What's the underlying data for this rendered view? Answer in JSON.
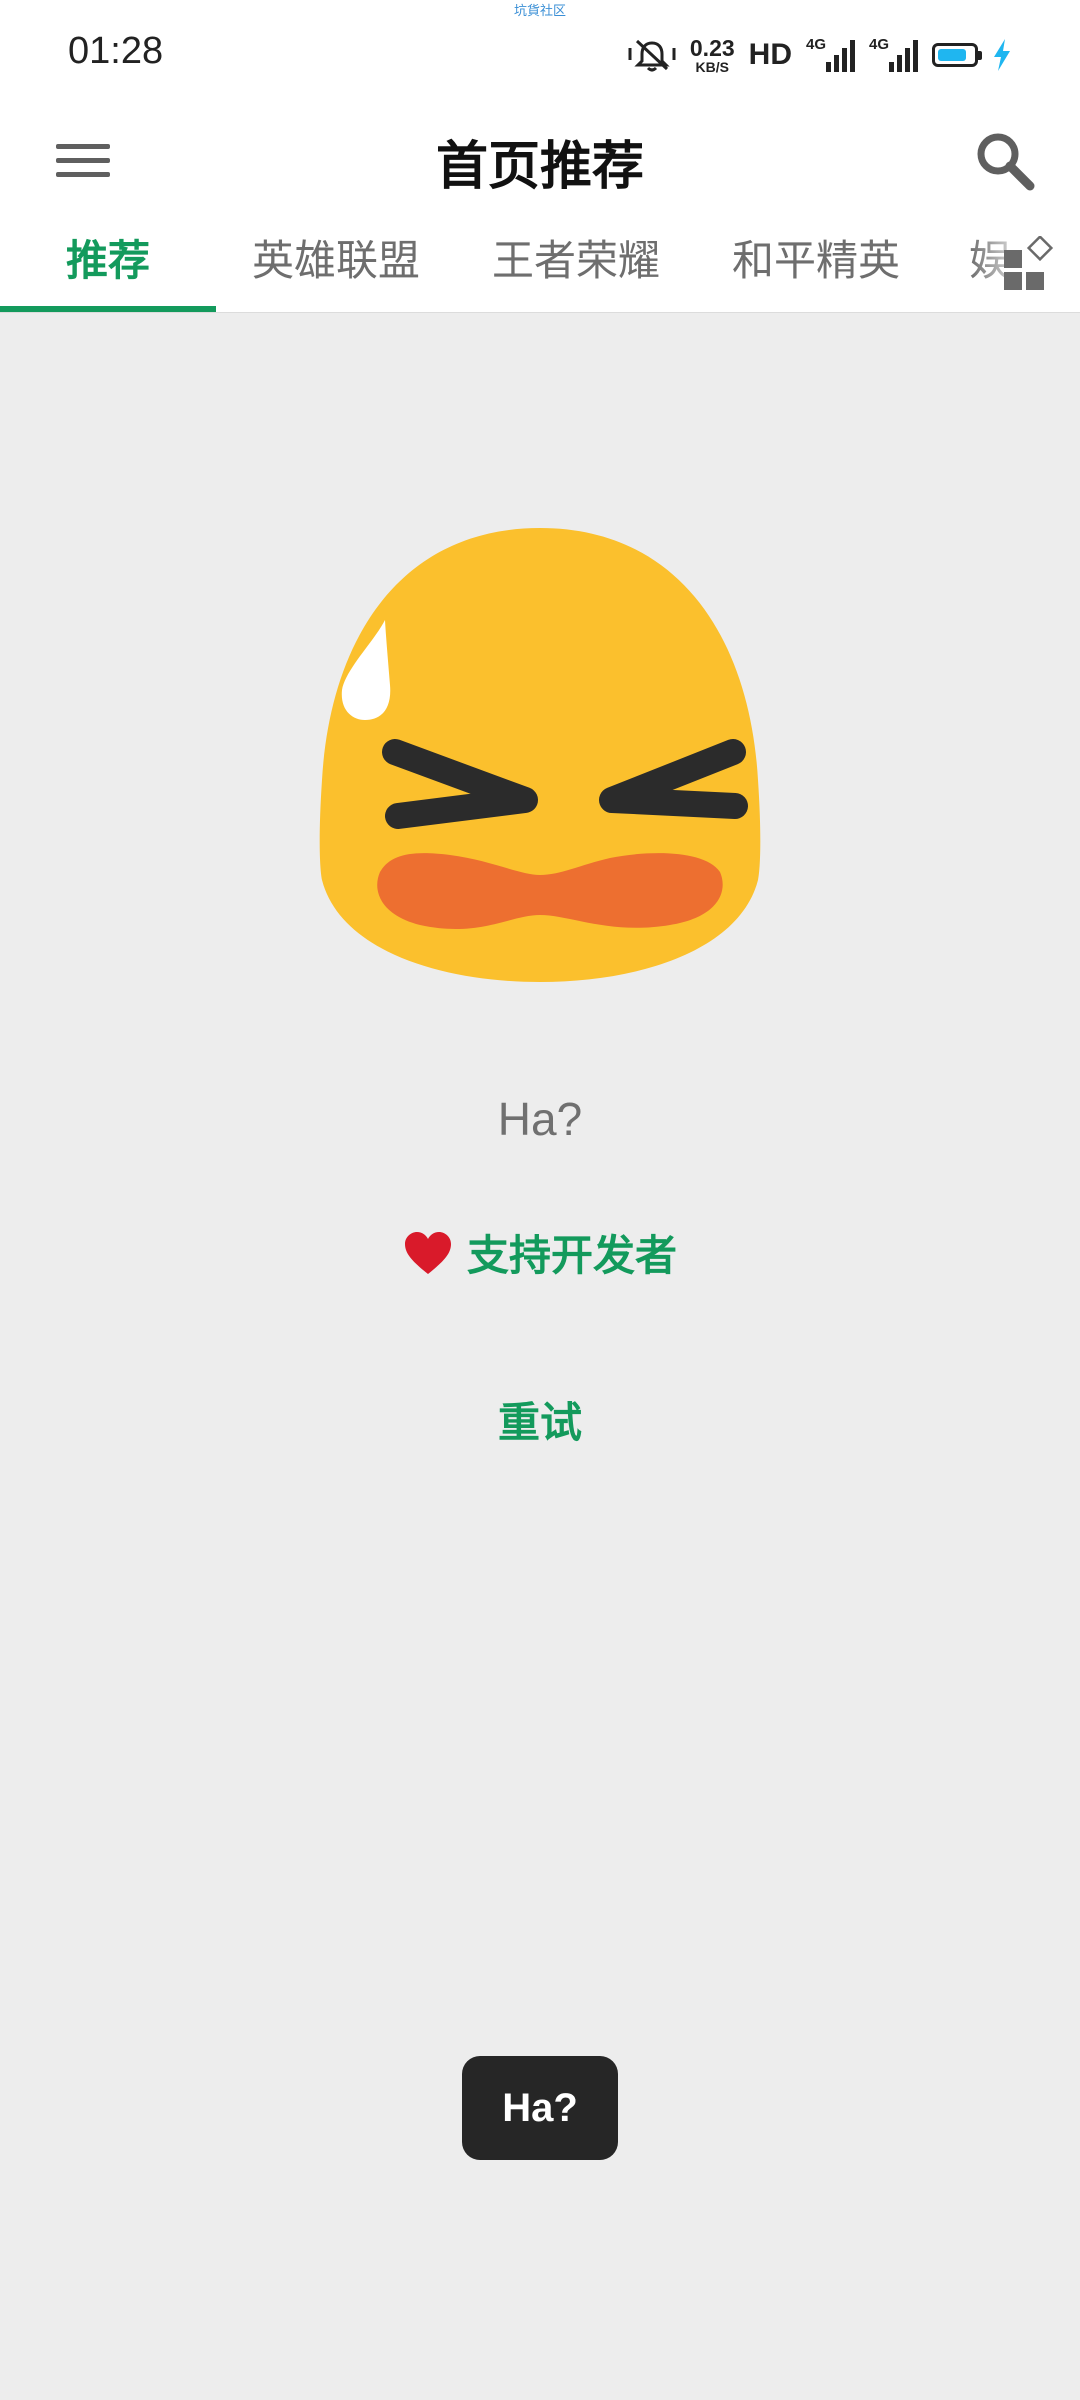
{
  "status_bar": {
    "top_label": "坑貨社区",
    "time": "01:28",
    "speed_value": "0.23",
    "speed_unit": "KB/S",
    "hd_label": "HD",
    "network_1": "4G",
    "network_2": "4G",
    "battery_color": "#1fb6f0",
    "icons": [
      "mute-vibrate-icon",
      "signal-icon",
      "battery-icon",
      "charging-icon"
    ]
  },
  "app_bar": {
    "title": "首页推荐",
    "menu_icon": "hamburger-menu-icon",
    "search_icon": "search-icon"
  },
  "tabs": [
    {
      "label": "推荐",
      "active": true
    },
    {
      "label": "英雄联盟",
      "active": false
    },
    {
      "label": "王者荣耀",
      "active": false
    },
    {
      "label": "和平精英",
      "active": false
    },
    {
      "label": "娱",
      "active": false
    }
  ],
  "tab_more_icon": "grid-category-icon",
  "error_state": {
    "illustration": "sweating-squint-face-emoji",
    "message": "Ha?",
    "support_label": "支持开发者",
    "support_icon": "heart-icon",
    "retry_label": "重试"
  },
  "toast": {
    "text": "Ha?"
  },
  "colors": {
    "accent": "#139a5c",
    "background": "#ededed",
    "toast_bg": "#262626"
  }
}
